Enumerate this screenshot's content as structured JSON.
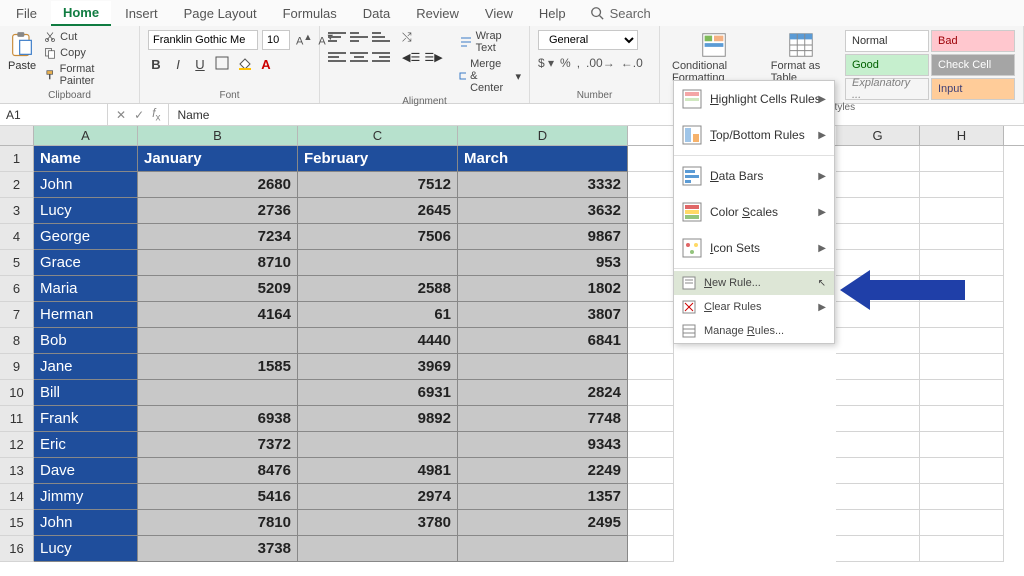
{
  "tabs": [
    "File",
    "Home",
    "Insert",
    "Page Layout",
    "Formulas",
    "Data",
    "Review",
    "View",
    "Help"
  ],
  "active_tab": 1,
  "search_placeholder": "Search",
  "clipboard": {
    "paste": "Paste",
    "cut": "Cut",
    "copy": "Copy",
    "format_painter": "Format Painter",
    "label": "Clipboard"
  },
  "font": {
    "name": "Franklin Gothic Me",
    "size": "10",
    "label": "Font"
  },
  "alignment": {
    "wrap": "Wrap Text",
    "merge": "Merge & Center",
    "label": "Alignment"
  },
  "number": {
    "format": "General",
    "label": "Number"
  },
  "styles": {
    "cond": "Conditional Formatting",
    "table": "Format as Table",
    "cells": {
      "normal": "Normal",
      "bad": "Bad",
      "good": "Good",
      "check": "Check Cell",
      "explanatory": "Explanatory ...",
      "input": "Input"
    },
    "label": "Styles"
  },
  "name_box": "A1",
  "formula_value": "Name",
  "columns": [
    "A",
    "B",
    "C",
    "D",
    "G",
    "H"
  ],
  "headers": [
    "Name",
    "January",
    "February",
    "March"
  ],
  "rows": [
    {
      "n": "John",
      "v": [
        2680,
        7512,
        3332
      ]
    },
    {
      "n": "Lucy",
      "v": [
        2736,
        2645,
        3632
      ]
    },
    {
      "n": "George",
      "v": [
        7234,
        7506,
        9867
      ]
    },
    {
      "n": "Grace",
      "v": [
        8710,
        null,
        953
      ]
    },
    {
      "n": "Maria",
      "v": [
        5209,
        2588,
        1802
      ]
    },
    {
      "n": "Herman",
      "v": [
        4164,
        61,
        3807
      ]
    },
    {
      "n": "Bob",
      "v": [
        null,
        4440,
        6841
      ]
    },
    {
      "n": "Jane",
      "v": [
        1585,
        3969,
        null
      ]
    },
    {
      "n": "Bill",
      "v": [
        null,
        6931,
        2824
      ]
    },
    {
      "n": "Frank",
      "v": [
        6938,
        9892,
        7748
      ]
    },
    {
      "n": "Eric",
      "v": [
        7372,
        null,
        9343
      ]
    },
    {
      "n": "Dave",
      "v": [
        8476,
        4981,
        2249
      ]
    },
    {
      "n": "Jimmy",
      "v": [
        5416,
        2974,
        1357
      ]
    },
    {
      "n": "John",
      "v": [
        7810,
        3780,
        2495
      ]
    },
    {
      "n": "Lucy",
      "v": [
        3738,
        null,
        null
      ]
    }
  ],
  "cf_menu": {
    "highlight": "Highlight Cells Rules",
    "topbottom": "Top/Bottom Rules",
    "databars": "Data Bars",
    "colorscales": "Color Scales",
    "iconsets": "Icon Sets",
    "newrule": "New Rule...",
    "clear": "Clear Rules",
    "manage": "Manage Rules..."
  }
}
